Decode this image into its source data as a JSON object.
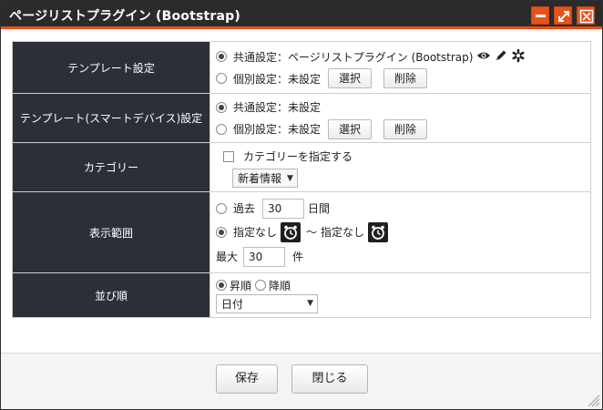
{
  "dialog": {
    "title": "ページリストプラグイン (Bootstrap)",
    "minimize_icon": "minimize-icon",
    "maximize_icon": "maximize-icon",
    "close_icon": "close-icon",
    "accent_color": "#e8521b"
  },
  "rows": {
    "template": {
      "label": "テンプレート設定",
      "common_label": "共通設定：ページリストプラグイン (Bootstrap)",
      "individual_label": "個別設定：未設定",
      "select_button": "選択",
      "delete_button": "削除",
      "common_selected": true
    },
    "template_smart": {
      "label": "テンプレート(スマートデバイス)設定",
      "common_label": "共通設定：未設定",
      "individual_label": "個別設定：未設定",
      "select_button": "選択",
      "delete_button": "削除",
      "common_selected": true
    },
    "category": {
      "label": "カテゴリー",
      "checkbox_label": "カテゴリーを指定する",
      "checked": false,
      "select_value": "新着情報"
    },
    "range": {
      "label": "表示範囲",
      "past_prefix": "過去",
      "past_value": "30",
      "past_suffix": "日間",
      "from_label": "指定なし",
      "tilde": "〜",
      "to_label": "指定なし",
      "max_prefix": "最大",
      "max_value": "30",
      "max_suffix": "件",
      "selected": "unspecified"
    },
    "order": {
      "label": "並び順",
      "asc_label": "昇順",
      "desc_label": "降順",
      "selected": "asc",
      "sort_value": "日付"
    }
  },
  "footer": {
    "save_button": "保存",
    "close_button": "閉じる"
  }
}
